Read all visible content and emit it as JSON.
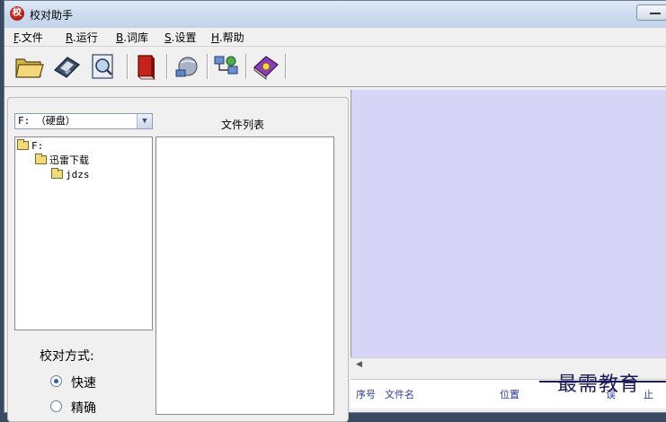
{
  "window": {
    "title": "校对助手"
  },
  "menu": [
    {
      "key": "F",
      "label": ".文件"
    },
    {
      "key": "R",
      "label": ".运行"
    },
    {
      "key": "B",
      "label": ".词库"
    },
    {
      "key": "S",
      "label": ".设置"
    },
    {
      "key": "H",
      "label": ".帮助"
    }
  ],
  "toolbar": {
    "icons": [
      "open-folder-icon",
      "floppy-save-icon",
      "search-document-icon",
      "red-book-icon",
      "network-globe-icon",
      "connect-icon",
      "help-book-icon"
    ]
  },
  "left_panel": {
    "drive_select": {
      "value": "F: （硬盘）"
    },
    "file_list_header": "文件列表",
    "tree": [
      {
        "label": "F:"
      },
      {
        "label": "迅雷下载"
      },
      {
        "label": "jdzs"
      }
    ],
    "proofreading": {
      "label": "校对方式:",
      "options": [
        {
          "label": "快速",
          "checked": true
        },
        {
          "label": "精确",
          "checked": false
        }
      ]
    }
  },
  "result_table": {
    "columns": [
      "序号",
      "文件名",
      "位置",
      "误",
      "止"
    ]
  },
  "watermark": "最需教育",
  "colors": {
    "content_bg": "#d6d4f7",
    "title_bar": "#c2d3ea"
  }
}
